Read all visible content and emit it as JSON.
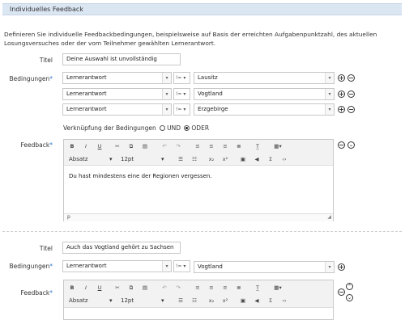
{
  "section_title": "Individuelles Feedback",
  "description": "Definieren Sie individuelle Feedbackbedingungen, beispielsweise auf Basis der erreichten Aufgabenpunktzahl, des aktuellen Losungsversuches oder der vom Teilnehmer gewählten Lernerantwort.",
  "labels": {
    "title": "Titel",
    "conditions": "Bedingungen",
    "feedback": "Feedback",
    "required": "*",
    "link_conditions": "Verknüpfung der Bedingungen",
    "und": "UND",
    "oder": "ODER"
  },
  "block1": {
    "title_value": "Deine Auswahl ist unvollständig",
    "conditions": [
      {
        "type": "Lernerantwort",
        "op": "!=",
        "value": "Lausitz"
      },
      {
        "type": "Lernerantwort",
        "op": "!=",
        "value": "Vogtland"
      },
      {
        "type": "Lernerantwort",
        "op": "!=",
        "value": "Erzgebirge"
      }
    ],
    "link_mode": "ODER",
    "editor": {
      "format": "Absatz",
      "size": "12pt",
      "content": "Du hast mindestens eine der Regionen vergessen.",
      "path": "p"
    }
  },
  "block2": {
    "title_value": "Auch das Vogtland gehört zu Sachsen",
    "conditions": [
      {
        "type": "Lernerantwort",
        "op": "!=",
        "value": "Vogtland"
      }
    ],
    "editor": {
      "format": "Absatz",
      "size": "12pt"
    }
  },
  "toolbar_icons": {
    "row1": [
      "bold-icon",
      "italic-icon",
      "underline-icon",
      "cut-icon",
      "copy-icon",
      "paste-icon",
      "undo-icon",
      "redo-icon",
      "align-left-icon",
      "align-center-icon",
      "align-right-icon",
      "justify-icon",
      "clear-format-icon",
      "table-icon"
    ],
    "row2": [
      "bullet-list-icon",
      "numbered-list-icon",
      "subscript-icon",
      "superscript-icon",
      "image-icon",
      "media-icon",
      "formula-icon",
      "code-icon"
    ]
  },
  "colors": {
    "header_bg": "#dbe6f3",
    "required": "#2f7bd1"
  }
}
